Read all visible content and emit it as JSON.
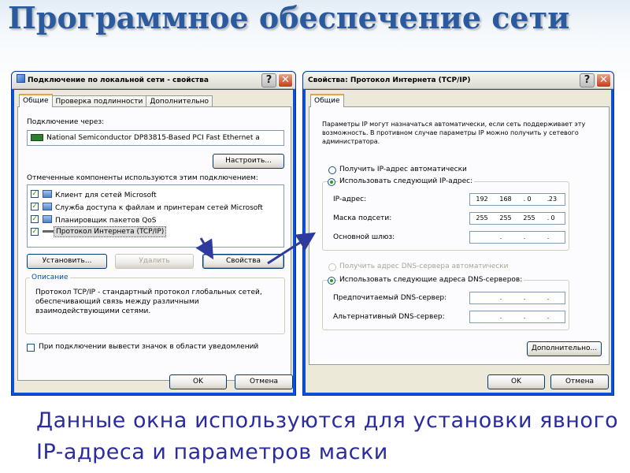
{
  "slide": {
    "title": "Программное обеспечение сети",
    "caption": "Данные окна используются для установки явного IP-адреса и параметров маски"
  },
  "left_window": {
    "title": "Подключение по локальной сети - свойства",
    "tabs": [
      "Общие",
      "Проверка подлинности",
      "Дополнительно"
    ],
    "connect_via_label": "Подключение через:",
    "adapter": "National Semiconductor DP83815-Based PCI Fast Ethernet a",
    "configure_button": "Настроить...",
    "components_label": "Отмеченные компоненты используются этим подключением:",
    "components": [
      {
        "label": "Клиент для сетей Microsoft",
        "checked": true
      },
      {
        "label": "Служба доступа к файлам и принтерам сетей Microsoft",
        "checked": true
      },
      {
        "label": "Планировщик пакетов QoS",
        "checked": true
      },
      {
        "label": "Протокол Интернета (TCP/IP)",
        "checked": true,
        "selected": true
      }
    ],
    "install_button": "Установить...",
    "remove_button": "Удалить",
    "properties_button": "Свойства",
    "description_title": "Описание",
    "description_text": "Протокол TCP/IP - стандартный протокол глобальных сетей, обеспечивающий связь между различными взаимодействующими сетями.",
    "show_icon_label": "При подключении вывести значок в области уведомлений",
    "show_icon_checked": false,
    "ok_button": "OK",
    "cancel_button": "Отмена"
  },
  "right_window": {
    "title": "Свойства: Протокол Интернета (TCP/IP)",
    "tab": "Общие",
    "intro_text": "Параметры IP могут назначаться автоматически, если сеть поддерживает эту возможность. В противном случае параметры IP можно получить у сетевого администратора.",
    "radio_auto_ip": "Получить IP-адрес автоматически",
    "radio_manual_ip": "Использовать следующий IP-адрес:",
    "ip_label": "IP-адрес:",
    "ip_value": [
      "192",
      "168",
      "0",
      "23"
    ],
    "mask_label": "Маска подсети:",
    "mask_value": [
      "255",
      "255",
      "255",
      "0"
    ],
    "gateway_label": "Основной шлюз:",
    "radio_auto_dns": "Получить адрес DNS-сервера автоматически",
    "radio_manual_dns": "Использовать следующие адреса DNS-серверов:",
    "dns_pref_label": "Предпочитаемый DNS-сервер:",
    "dns_alt_label": "Альтернативный DNS-сервер:",
    "advanced_button": "Дополнительно...",
    "ok_button": "OK",
    "cancel_button": "Отмена"
  },
  "window_buttons": {
    "help": "?",
    "close": "✕"
  },
  "colors": {
    "title_blue": "#2b5b9e",
    "caption_blue": "#2b2ba0",
    "arrow": "#2e3a9e",
    "xp_face": "#ece9d8",
    "group_title": "#0046d5"
  }
}
